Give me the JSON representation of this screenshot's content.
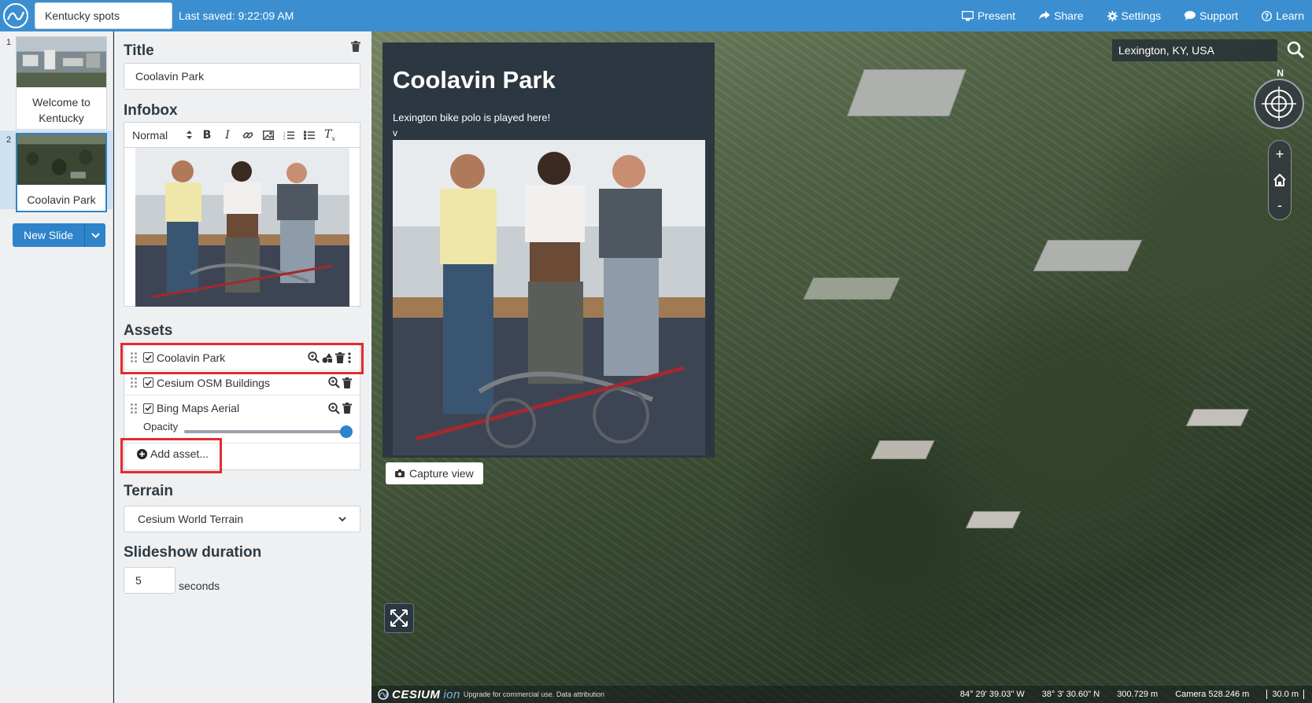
{
  "topbar": {
    "story_name": "Kentucky spots",
    "last_saved": "Last saved: 9:22:09 AM",
    "nav": [
      {
        "label": "Present",
        "icon": "monitor-icon"
      },
      {
        "label": "Share",
        "icon": "share-icon"
      },
      {
        "label": "Settings",
        "icon": "gear-icon"
      },
      {
        "label": "Support",
        "icon": "chat-icon"
      },
      {
        "label": "Learn",
        "icon": "help-icon"
      }
    ]
  },
  "slides": [
    {
      "number": "1",
      "label": "Welcome to Kentucky"
    },
    {
      "number": "2",
      "label": "Coolavin Park"
    }
  ],
  "new_slide_label": "New Slide",
  "editor": {
    "title_heading": "Title",
    "title_value": "Coolavin Park",
    "infobox_heading": "Infobox",
    "format_select": "Normal",
    "assets_heading": "Assets",
    "assets": [
      {
        "label": "Coolavin Park",
        "checked": true
      },
      {
        "label": "Cesium OSM Buildings",
        "checked": true
      },
      {
        "label": "Bing Maps Aerial",
        "checked": true
      }
    ],
    "opacity_label": "Opacity",
    "opacity_value": 1.0,
    "add_asset_label": "Add asset...",
    "terrain_heading": "Terrain",
    "terrain_value": "Cesium World Terrain",
    "duration_heading": "Slideshow duration",
    "duration_value": "5",
    "duration_unit": "seconds"
  },
  "viewer": {
    "search_value": "Lexington, KY, USA",
    "compass_label": "N",
    "infobox": {
      "title": "Coolavin Park",
      "text": "Lexington bike polo is played here!",
      "extra": "v"
    },
    "capture_label": "Capture view",
    "credits": {
      "logo": "CESIUM",
      "logo_suffix": "ion",
      "text": "Upgrade for commercial use.  Data attribution"
    },
    "coords": {
      "lon": "84° 29' 39.03\" W",
      "lat": "38° 3' 30.60\" N",
      "height": "300.729 m",
      "camera": "Camera 528.246 m",
      "scale": "30.0 m"
    }
  },
  "colors": {
    "accent": "#3b8fd0",
    "button": "#2f83c8",
    "highlight": "#e32b2b",
    "infobox_bg": "#2d3741"
  }
}
